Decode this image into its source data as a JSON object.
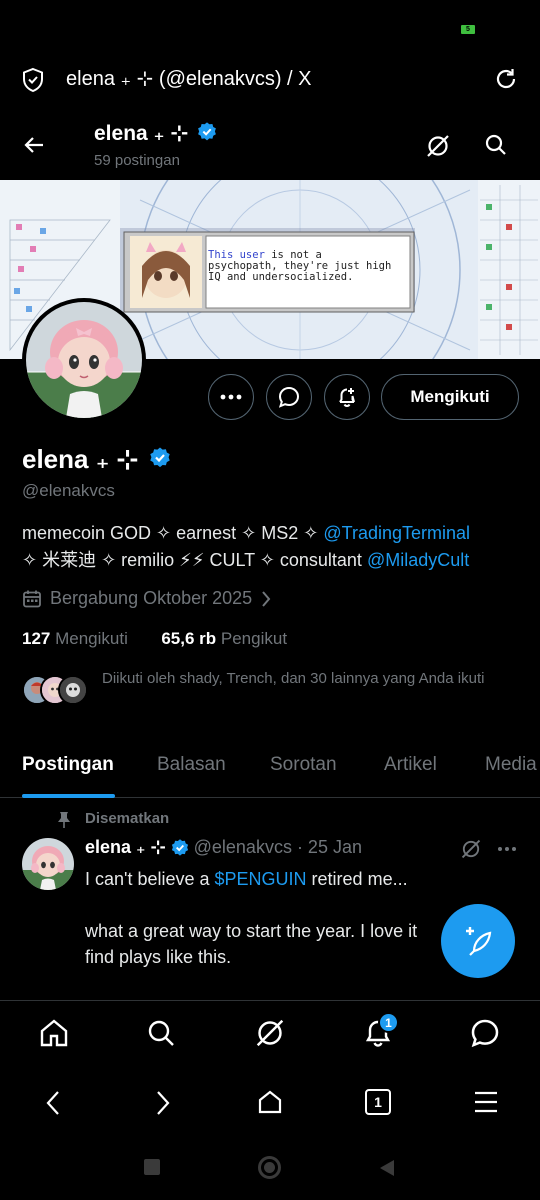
{
  "status_bar": {
    "battery": "5"
  },
  "browser": {
    "title": "elena ₊ ⊹ (@elenakvcs) / X"
  },
  "header": {
    "name": "elena ₊ ⊹",
    "post_count": "59 postingan"
  },
  "banner": {
    "dialog_text_highlight": "This user",
    "dialog_text_rest_1": " is not a",
    "dialog_text_2": "psychopath, they're just high",
    "dialog_text_3": "IQ and undersocialized."
  },
  "profile": {
    "follow_button": "Mengikuti",
    "name": "elena ₊ ⊹",
    "handle": "@elenakvcs",
    "bio_part1": "memecoin GOD ✧ earnest ✧ MS2 ✧ ",
    "bio_link1": "@TradingTerminal",
    "bio_part2": "✧ 米莱迪 ✧ remilio ⚡⚡ CULT ✧ consultant ",
    "bio_link2": "@MiladyCult",
    "joined": "Bergabung Oktober 2025",
    "following_count": "127",
    "following_label": "Mengikuti",
    "followers_count": "65,6 rb",
    "followers_label": "Pengikut",
    "followed_by": "Diikuti oleh shady, Trench, dan 30 lainnya yang Anda ikuti"
  },
  "tabs": [
    "Postingan",
    "Balasan",
    "Sorotan",
    "Artikel",
    "Media"
  ],
  "post": {
    "pinned_label": "Disematkan",
    "author": "elena ₊ ⊹",
    "meta": "@elenakvcs · 25 Jan",
    "text_line1_a": "I can't believe a ",
    "cashtag": "$PENGUIN",
    "text_line1_b": " retired me...",
    "text_line2": "what a great way to start the year. I love it",
    "text_line3": "find plays like this."
  },
  "nav": {
    "notifications_badge": "1"
  },
  "browser_nav": {
    "tab_count": "1"
  },
  "colors": {
    "accent": "#1d9bf0",
    "background": "#000000",
    "muted": "#71767b"
  },
  "icons": [
    "shield-icon",
    "reload-icon",
    "back-arrow-icon",
    "grok-icon",
    "search-icon",
    "more-icon",
    "message-icon",
    "bell-plus-icon",
    "verified-badge-icon",
    "calendar-icon",
    "chevron-right-icon",
    "pin-icon",
    "compose-icon",
    "home-icon",
    "bell-icon"
  ]
}
